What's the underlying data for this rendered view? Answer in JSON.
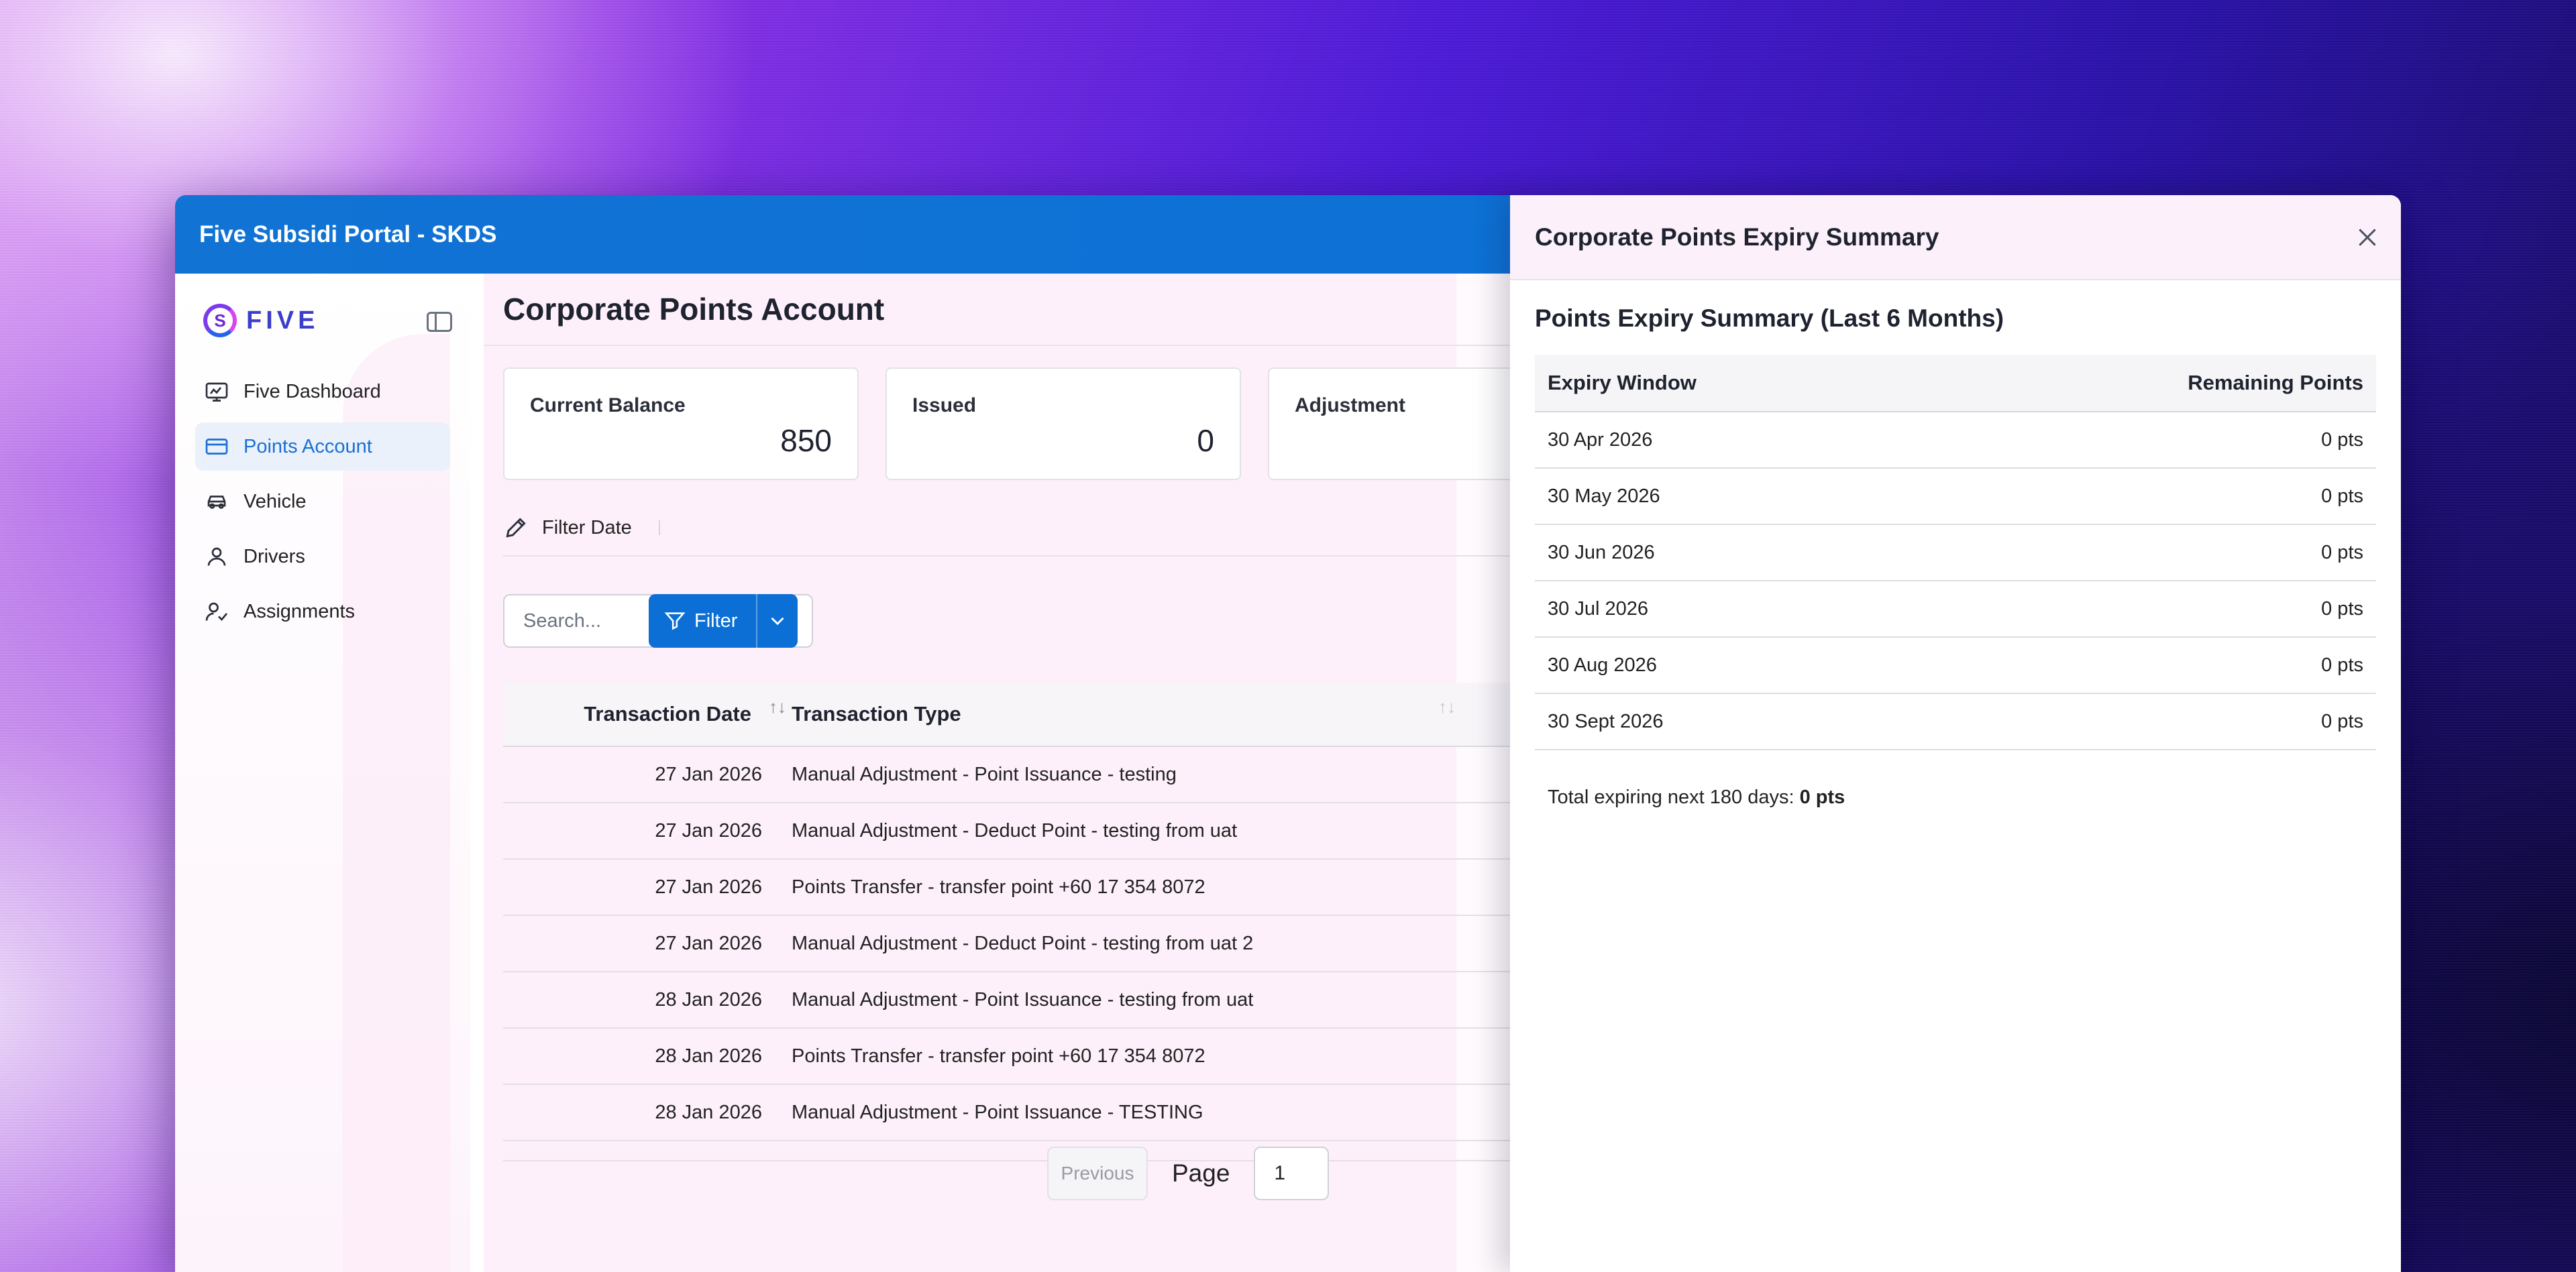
{
  "app": {
    "title": "Five Subsidi Portal - SKDS",
    "logo_letter": "S",
    "logo_text": "FIVE"
  },
  "sidebar": {
    "items": [
      {
        "label": "Five Dashboard",
        "icon": "dashboard-icon"
      },
      {
        "label": "Points Account",
        "icon": "wallet-icon",
        "active": true
      },
      {
        "label": "Vehicle",
        "icon": "car-icon"
      },
      {
        "label": "Drivers",
        "icon": "user-icon"
      },
      {
        "label": "Assignments",
        "icon": "user-assign-icon"
      }
    ]
  },
  "main": {
    "page_title": "Corporate Points Account",
    "cards": [
      {
        "label": "Current Balance",
        "value": "850"
      },
      {
        "label": "Issued",
        "value": "0"
      },
      {
        "label": "Adjustment",
        "value": ""
      }
    ],
    "filter_date_label": "Filter Date",
    "search_placeholder": "Search...",
    "filter_button_label": "Filter",
    "table": {
      "columns": [
        "Transaction Date",
        "Transaction Type"
      ],
      "rows": [
        {
          "date": "27 Jan 2026",
          "type": "Manual Adjustment - Point Issuance - testing"
        },
        {
          "date": "27 Jan 2026",
          "type": "Manual Adjustment - Deduct Point - testing from uat"
        },
        {
          "date": "27 Jan 2026",
          "type": "Points Transfer - transfer point +60 17 354 8072"
        },
        {
          "date": "27 Jan 2026",
          "type": "Manual Adjustment - Deduct Point - testing from uat 2"
        },
        {
          "date": "28 Jan 2026",
          "type": "Manual Adjustment - Point Issuance - testing from uat"
        },
        {
          "date": "28 Jan 2026",
          "type": "Points Transfer - transfer point +60 17 354 8072"
        },
        {
          "date": "28 Jan 2026",
          "type": "Manual Adjustment - Point Issuance - TESTING"
        }
      ]
    },
    "pagination": {
      "previous_label": "Previous",
      "page_label": "Page",
      "page_value": "1"
    }
  },
  "drawer": {
    "title": "Corporate Points Expiry Summary",
    "subtitle": "Points Expiry Summary (Last 6 Months)",
    "columns": [
      "Expiry Window",
      "Remaining Points"
    ],
    "rows": [
      {
        "window": "30 Apr 2026",
        "points": "0 pts"
      },
      {
        "window": "30 May 2026",
        "points": "0 pts"
      },
      {
        "window": "30 Jun 2026",
        "points": "0 pts"
      },
      {
        "window": "30 Jul 2026",
        "points": "0 pts"
      },
      {
        "window": "30 Aug 2026",
        "points": "0 pts"
      },
      {
        "window": "30 Sept 2026",
        "points": "0 pts"
      }
    ],
    "total_label": "Total expiring next 180 days:",
    "total_value": "0 pts"
  },
  "colors": {
    "primary": "#0b6fd6",
    "active_nav_bg": "#eaf1fb",
    "panel_tint": "#fdf0fa"
  }
}
